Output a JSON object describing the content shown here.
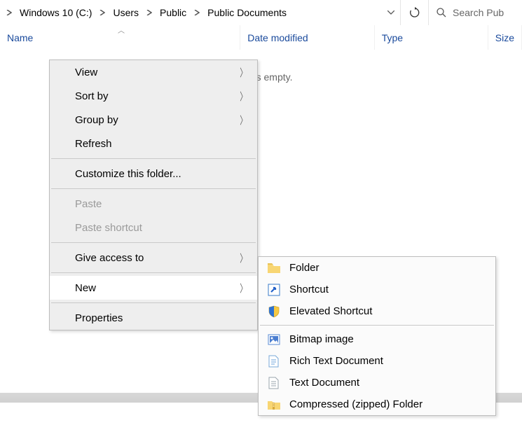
{
  "breadcrumb": {
    "items": [
      "Windows 10 (C:)",
      "Users",
      "Public",
      "Public Documents"
    ]
  },
  "search": {
    "placeholder": "Search Pub"
  },
  "columns": {
    "name": "Name",
    "date": "Date modified",
    "type": "Type",
    "size": "Size"
  },
  "empty_message": "older is empty.",
  "context_menu": {
    "view": "View",
    "sort_by": "Sort by",
    "group_by": "Group by",
    "refresh": "Refresh",
    "customize": "Customize this folder...",
    "paste": "Paste",
    "paste_shortcut": "Paste shortcut",
    "give_access": "Give access to",
    "new": "New",
    "properties": "Properties"
  },
  "new_submenu": {
    "folder": "Folder",
    "shortcut": "Shortcut",
    "elevated_shortcut": "Elevated Shortcut",
    "bitmap": "Bitmap image",
    "rtf": "Rich Text Document",
    "txt": "Text Document",
    "zip": "Compressed (zipped) Folder"
  }
}
